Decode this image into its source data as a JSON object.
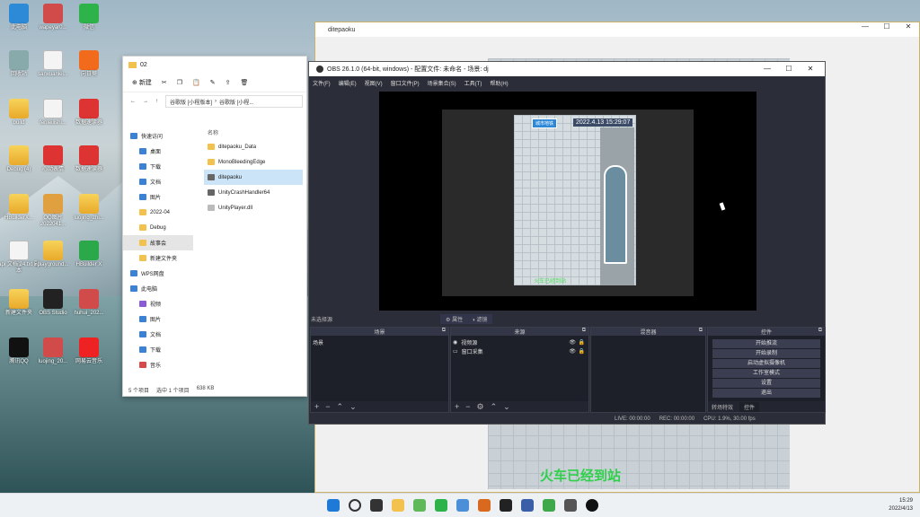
{
  "desktop": {
    "icons": [
      {
        "label": "此电脑",
        "icon": "computer-icon"
      },
      {
        "label": "wapeyar0...",
        "icon": "archive-icon"
      },
      {
        "label": "微信",
        "icon": "wechat-icon"
      },
      {
        "label": "回收站",
        "icon": "recycle-bin-icon"
      },
      {
        "label": "sanxuanlei...",
        "icon": "file-icon"
      },
      {
        "label": "向日葵",
        "icon": "sunlogin-icon"
      },
      {
        "label": "build",
        "icon": "folder-icon"
      },
      {
        "label": "fenleilishi...",
        "icon": "file-icon"
      },
      {
        "label": "数据速读器",
        "icon": "app-icon"
      },
      {
        "label": "Debug (4)",
        "icon": "folder-icon"
      },
      {
        "label": "心动表情",
        "icon": "app-icon"
      },
      {
        "label": "数据速读器",
        "icon": "app-icon"
      },
      {
        "label": "HBuilderX...",
        "icon": "folder-icon"
      },
      {
        "label": "QQ图片 2022041...",
        "icon": "image-icon"
      },
      {
        "label": "luojing_zhi...",
        "icon": "folder-icon"
      },
      {
        "label": "api 文档 24.txt 副本",
        "icon": "file-icon"
      },
      {
        "label": "playground...",
        "icon": "folder-icon"
      },
      {
        "label": "HBuilder X",
        "icon": "hbuilder-icon"
      },
      {
        "label": "新建文件夹",
        "icon": "folder-icon"
      },
      {
        "label": "OBS Studio",
        "icon": "obs-icon"
      },
      {
        "label": "huhui_202...",
        "icon": "archive-icon"
      },
      {
        "label": "腾讯QQ",
        "icon": "qq-icon"
      },
      {
        "label": "luojing_20...",
        "icon": "archive-icon"
      },
      {
        "label": "网易云音乐",
        "icon": "music-icon"
      }
    ]
  },
  "game_window": {
    "title": "ditepaoku",
    "caption": "火车已经到站"
  },
  "explorer": {
    "tab": "02",
    "new_label": "新建",
    "path_parts": [
      "谷歌版 [小程版本]",
      "谷歌版 [小程..."
    ],
    "nav": [
      {
        "label": "快速访问",
        "icon": "star-icon",
        "kind": "header"
      },
      {
        "label": "桌面",
        "icon": "desktop-icon",
        "kind": "blue"
      },
      {
        "label": "下载",
        "icon": "download-icon",
        "kind": "blue"
      },
      {
        "label": "文档",
        "icon": "document-icon",
        "kind": "blue"
      },
      {
        "label": "图片",
        "icon": "picture-icon",
        "kind": "blue"
      },
      {
        "label": "2022-04",
        "icon": "folder-icon",
        "kind": "folder"
      },
      {
        "label": "Debug",
        "icon": "folder-icon",
        "kind": "folder"
      },
      {
        "label": "故事会",
        "icon": "folder-icon",
        "kind": "folder"
      },
      {
        "label": "新建文件夹",
        "icon": "folder-icon",
        "kind": "folder"
      },
      {
        "label": "WPS网盘",
        "icon": "cloud-icon",
        "kind": "blue"
      },
      {
        "label": "此电脑",
        "icon": "computer-icon",
        "kind": "blue"
      },
      {
        "label": "视频",
        "icon": "video-icon",
        "kind": "purple"
      },
      {
        "label": "图片",
        "icon": "picture-icon",
        "kind": "blue"
      },
      {
        "label": "文档",
        "icon": "document-icon",
        "kind": "blue"
      },
      {
        "label": "下载",
        "icon": "download-icon",
        "kind": "blue"
      },
      {
        "label": "音乐",
        "icon": "music-icon",
        "kind": "red"
      }
    ],
    "files_header": "名称",
    "files": [
      {
        "name": "ditepaoku_Data",
        "icon": "folder-icon"
      },
      {
        "name": "MonoBleedingEdge",
        "icon": "folder-icon"
      },
      {
        "name": "ditepaoku",
        "icon": "app-icon"
      },
      {
        "name": "UnityCrashHandler64",
        "icon": "app-icon"
      },
      {
        "name": "UnityPlayer.dll",
        "icon": "dll-icon"
      }
    ],
    "status": [
      "5 个项目",
      "选中 1 个项目",
      "638 KB"
    ]
  },
  "obs": {
    "title": "OBS 26.1.0 (64-bit, windows) - 配置文件: 未命名 - 场景: dj",
    "menu": [
      "文件(F)",
      "编辑(E)",
      "视图(V)",
      "窗口文件(P)",
      "场景集合(S)",
      "工具(T)",
      "帮助(H)"
    ],
    "preview": {
      "timestamp": "2022.4.13 15:29:07",
      "badge": "城市地铁",
      "green_text": "火车已经到站"
    },
    "toolbar": {
      "no_source": "未选择源",
      "properties": "属性",
      "filters": "滤镜"
    },
    "docks": {
      "scenes": {
        "title": "场景",
        "items": [
          "场景"
        ]
      },
      "sources": {
        "title": "来源",
        "items": [
          "视频源",
          "窗口采集"
        ]
      },
      "mixer": {
        "title": "混音器"
      },
      "controls": {
        "title": "控件",
        "buttons": [
          "开始推流",
          "开始录制",
          "启动虚拟摄像机",
          "工作室模式",
          "设置",
          "退出"
        ]
      }
    },
    "transition_tabs": [
      "转场特效",
      "控件"
    ],
    "status": {
      "live": "LIVE: 00:00:00",
      "rec": "REC: 00:00:00",
      "cpu": "CPU: 1.9%, 30.00 fps"
    }
  },
  "taskbar": {
    "time": "15:29",
    "date": "2022/4/13"
  }
}
